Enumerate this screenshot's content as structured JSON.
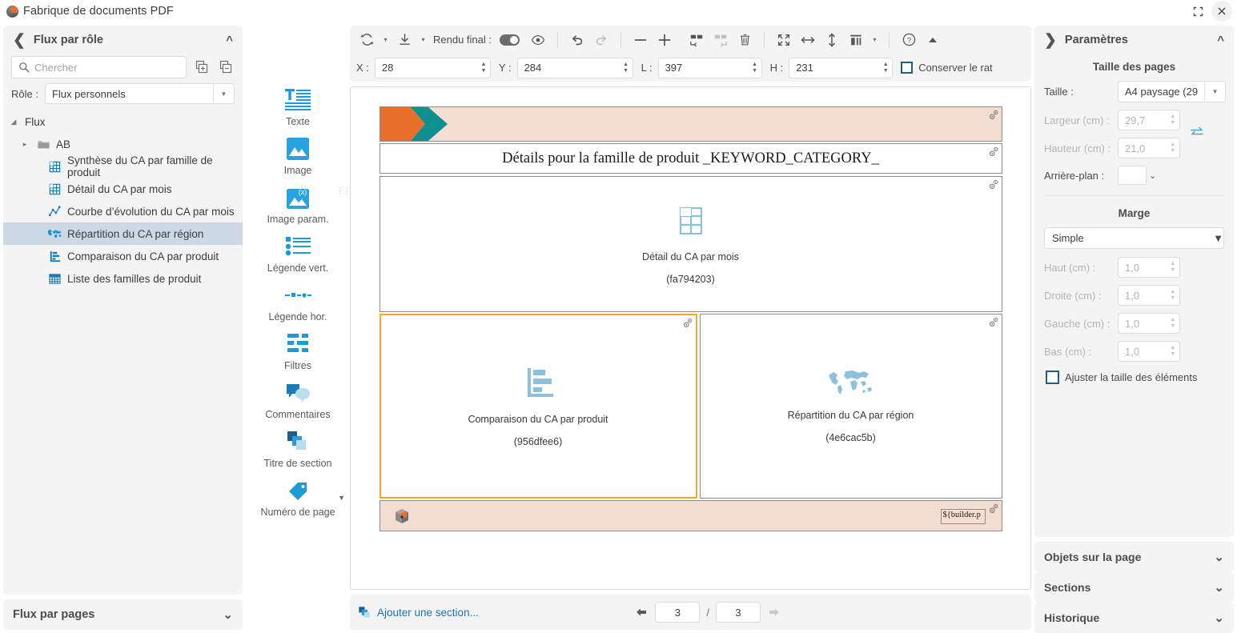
{
  "window": {
    "title": "Fabrique de documents PDF",
    "app_icon": "pdf-factory-icon",
    "restore_label": "⛶",
    "close_label": "✕"
  },
  "left_panel": {
    "back_icon": "chevron-left-icon",
    "title": "Flux par rôle",
    "collapse_icon": "chevron-up-icon",
    "search": {
      "placeholder": "Chercher",
      "value": "",
      "icon": "search-icon"
    },
    "tree_buttons": [
      {
        "name": "expand-all-button",
        "icon": "expand-all-icon"
      },
      {
        "name": "collapse-all-button",
        "icon": "collapse-all-icon"
      }
    ],
    "role": {
      "label": "Rôle :",
      "value": "Flux personnels",
      "arrow": "▼"
    },
    "tree": [
      {
        "label": "Flux",
        "depth": 0,
        "icon": "none",
        "twisty": "open",
        "selected": false
      },
      {
        "label": "AB",
        "depth": 1,
        "icon": "folder",
        "twisty": "closed",
        "selected": false
      },
      {
        "label": "Synthèse du CA par famille de produit",
        "depth": 2,
        "icon": "table",
        "twisty": "none",
        "selected": false
      },
      {
        "label": "Détail du CA par mois",
        "depth": 2,
        "icon": "table",
        "twisty": "none",
        "selected": false
      },
      {
        "label": "Courbe d’évolution du CA par mois",
        "depth": 2,
        "icon": "linechart",
        "twisty": "none",
        "selected": false
      },
      {
        "label": "Répartition du CA par région",
        "depth": 2,
        "icon": "map",
        "twisty": "none",
        "selected": true
      },
      {
        "label": "Comparaison du CA par produit",
        "depth": 2,
        "icon": "barchart",
        "twisty": "none",
        "selected": false
      },
      {
        "label": "Liste des familles de produit",
        "depth": 2,
        "icon": "grid",
        "twisty": "none",
        "selected": false
      }
    ],
    "flux_pages": {
      "title": "Flux par pages",
      "expand_icon": "chevron-down-icon"
    }
  },
  "palette": {
    "items": [
      {
        "label": "Texte",
        "icon": "text-icon"
      },
      {
        "label": "Image",
        "icon": "image-icon"
      },
      {
        "label": "Image param.",
        "icon": "parametric-image-icon"
      },
      {
        "label": "Légende vert.",
        "icon": "vertical-legend-icon"
      },
      {
        "label": "Légende hor.",
        "icon": "horizontal-legend-icon"
      },
      {
        "label": "Filtres",
        "icon": "filters-icon"
      },
      {
        "label": "Commentaires",
        "icon": "comments-icon"
      },
      {
        "label": "Titre de section",
        "icon": "section-title-icon"
      },
      {
        "label": "Numéro de page",
        "icon": "page-number-icon"
      }
    ],
    "more_icon": "chevron-down-icon"
  },
  "toolbar": {
    "refresh_icon": "refresh-icon",
    "refresh_caret": "▾",
    "download_icon": "download-icon",
    "download_caret": "▾",
    "render_label": "Rendu final :",
    "render_toggle_on": true,
    "preview_icon": "eye-icon",
    "undo_icon": "undo-icon",
    "redo_icon": "redo-icon",
    "zoom_out_icon": "minus-icon",
    "zoom_in_icon": "plus-icon",
    "add_row_icon": "insert-row-icon",
    "add_col_icon": "insert-column-icon",
    "delete_icon": "trash-icon",
    "fit_icon": "fit-page-icon",
    "fit_width_icon": "fit-width-icon",
    "fit_height_icon": "fit-height-icon",
    "layout_icon": "layout-icon",
    "layout_caret": "▾",
    "help_icon": "help-icon",
    "collapse_icon": "chevron-up-icon",
    "fields": {
      "x": {
        "label": "X :",
        "value": "28"
      },
      "y": {
        "label": "Y :",
        "value": "284"
      },
      "l": {
        "label": "L :",
        "value": "397"
      },
      "h": {
        "label": "H :",
        "value": "231"
      }
    },
    "keep_ratio": {
      "label": "Conserver le rat",
      "checked": false
    }
  },
  "canvas": {
    "header_banner": {
      "name": "header-banner",
      "logo": "chevron-logo"
    },
    "title_block": {
      "text": "Détails pour la famille de produit _KEYWORD_CATEGORY_"
    },
    "widgets": [
      {
        "name": "Détail du CA par mois",
        "id": "(fa794203)",
        "icon": "table-icon",
        "selected": false
      },
      {
        "name": "Comparaison du CA par produit",
        "id": "(956dfee6)",
        "icon": "barchart-icon",
        "selected": true
      },
      {
        "name": "Répartition du CA par région",
        "id": "(4e6cac5b)",
        "icon": "worldmap-icon",
        "selected": false
      }
    ],
    "footer_banner": {
      "logo": "cube-logo",
      "token": "${builder.p"
    },
    "gear_icon": "gears-icon",
    "colors": {
      "banner": "#f4ded2",
      "logo_orange": "#e8702a",
      "logo_teal": "#0e9090",
      "selection": "#f0a828"
    }
  },
  "bottombar": {
    "add_section": {
      "label": "Ajouter une section...",
      "icon": "section-icon"
    },
    "prev_icon": "arrow-left-icon",
    "next_icon": "arrow-right-icon",
    "current_page": "3",
    "separator": "/",
    "total_pages": "3"
  },
  "right_panel": {
    "expand_icon": "chevron-right-icon",
    "title": "Paramètres",
    "collapse_icon": "chevron-up-icon",
    "page_size": {
      "section_title": "Taille des pages",
      "size": {
        "label": "Taille :",
        "value": "A4 paysage (29",
        "arrow": "▼"
      },
      "width": {
        "label": "Largeur (cm) :",
        "value": "29,7",
        "disabled": true
      },
      "height": {
        "label": "Hauteur (cm) :",
        "value": "21,0",
        "disabled": true
      },
      "swap_icon": "swap-icon",
      "background": {
        "label": "Arrière-plan :",
        "value": "#ffffff",
        "arrow": "⌄"
      }
    },
    "margin": {
      "section_title": "Marge",
      "preset": {
        "value": "Simple",
        "arrow": "▼"
      },
      "top": {
        "label": "Haut (cm) :",
        "value": "1,0",
        "disabled": true
      },
      "right": {
        "label": "Droite (cm) :",
        "value": "1,0",
        "disabled": true
      },
      "left": {
        "label": "Gauche (cm) :",
        "value": "1,0",
        "disabled": true
      },
      "bottom": {
        "label": "Bas (cm) :",
        "value": "1,0",
        "disabled": true
      },
      "fit_elements": {
        "label": "Ajuster la taille des éléments",
        "checked": false
      }
    },
    "accordions": [
      {
        "label": "Objets sur la page",
        "icon": "chevron-down-icon"
      },
      {
        "label": "Sections",
        "icon": "chevron-down-icon"
      },
      {
        "label": "Historique",
        "icon": "chevron-down-icon"
      }
    ]
  }
}
